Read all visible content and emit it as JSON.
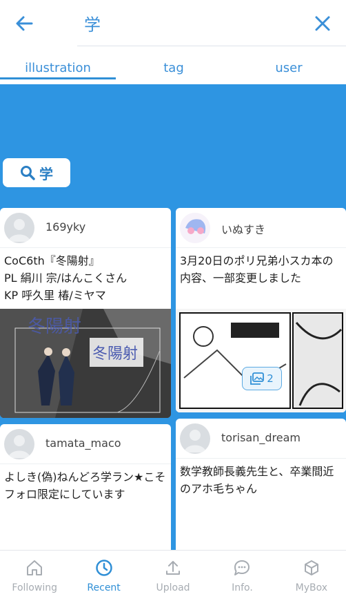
{
  "search": {
    "query": "学"
  },
  "tabs": [
    {
      "label": "illustration",
      "active": true
    },
    {
      "label": "tag",
      "active": false
    },
    {
      "label": "user",
      "active": false
    }
  ],
  "search_chip": {
    "label": "学",
    "icon": "search-icon"
  },
  "cards": [
    {
      "username": "169yky",
      "text": "CoC6th『冬陽射』\nPL 絹川 宗/はんこくさん\nKP 呼久里 椿/ミヤマ",
      "thumb_caption": "冬陽射"
    },
    {
      "username": "いぬすき",
      "text": "3月20日のポリ兄弟小スカ本の内容、一部変更しました",
      "image_count": "2"
    },
    {
      "username": "tamata_maco",
      "text": "よしき(偽)ねんどろ学ラン★こそフォロ限定にしています"
    },
    {
      "username": "torisan_dream",
      "text": "数学教師長義先生と、卒業間近のアホ毛ちゃん"
    }
  ],
  "nav": [
    {
      "label": "Following",
      "icon": "home-icon",
      "active": false
    },
    {
      "label": "Recent",
      "icon": "clock-icon",
      "active": true
    },
    {
      "label": "Upload",
      "icon": "upload-icon",
      "active": false
    },
    {
      "label": "Info.",
      "icon": "chat-icon",
      "active": false
    },
    {
      "label": "MyBox",
      "icon": "box-icon",
      "active": false
    }
  ],
  "colors": {
    "accent": "#2f8fd6",
    "background_blue": "#2e95e2",
    "inactive": "#a7acb2"
  }
}
